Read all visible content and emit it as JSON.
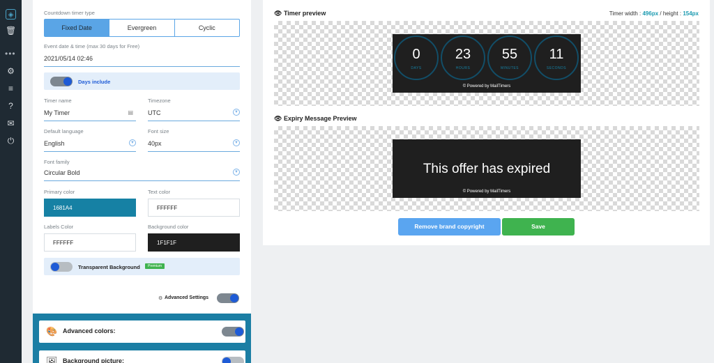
{
  "sidebar": {
    "icons": [
      "brand-icon",
      "trash-icon",
      "more-dots-icon",
      "settings-icon",
      "database-icon",
      "help-icon",
      "mail-icon",
      "power-icon"
    ]
  },
  "settings": {
    "timer_type_label": "Countdown timer type",
    "timer_types": [
      "Fixed Date",
      "Evergreen",
      "Cyclic"
    ],
    "timer_type_selected": "Fixed Date",
    "event_label": "Event date & time (max 30 days for Free)",
    "event_value": "2021/05/14 02:46",
    "days_include_label": "Days include",
    "timer_name_label": "Timer name",
    "timer_name_value": "My Timer",
    "timezone_label": "Timezone",
    "timezone_value": "UTC",
    "language_label": "Default language",
    "language_value": "English",
    "font_size_label": "Font size",
    "font_size_value": "40px",
    "font_family_label": "Font family",
    "font_family_value": "Circular Bold",
    "primary_color_label": "Primary color",
    "primary_color_value": "1681A4",
    "text_color_label": "Text color",
    "text_color_value": "FFFFFF",
    "labels_color_label": "Labels Color",
    "labels_color_value": "FFFFFF",
    "background_color_label": "Background color",
    "background_color_value": "1F1F1F",
    "transparent_bg_label": "Transparent Background",
    "premium_badge": "Premium",
    "advanced_settings_label": "Advanced Settings",
    "advanced_colors_label": "Advanced colors:",
    "background_picture_label": "Background picture:"
  },
  "preview": {
    "timer_title": "Timer preview",
    "width_label": "Timer width :",
    "width_value": "496px",
    "height_sep": "/ height :",
    "height_value": "154px",
    "units": [
      {
        "value": "0",
        "label": "DAYS"
      },
      {
        "value": "23",
        "label": "HOURS"
      },
      {
        "value": "55",
        "label": "MINUTES"
      },
      {
        "value": "11",
        "label": "SECONDS"
      }
    ],
    "powered_by": "© Powered by MailTimers",
    "expiry_title": "Expiry Message Preview",
    "expired_message": "This offer has expired",
    "remove_copyright_button": "Remove brand copyright",
    "save_button": "Save"
  },
  "colors": {
    "primary": "#1681A4",
    "background": "#1F1F1F",
    "text": "#FFFFFF",
    "accent": "#5AA5E6",
    "save": "#3FB34F"
  }
}
